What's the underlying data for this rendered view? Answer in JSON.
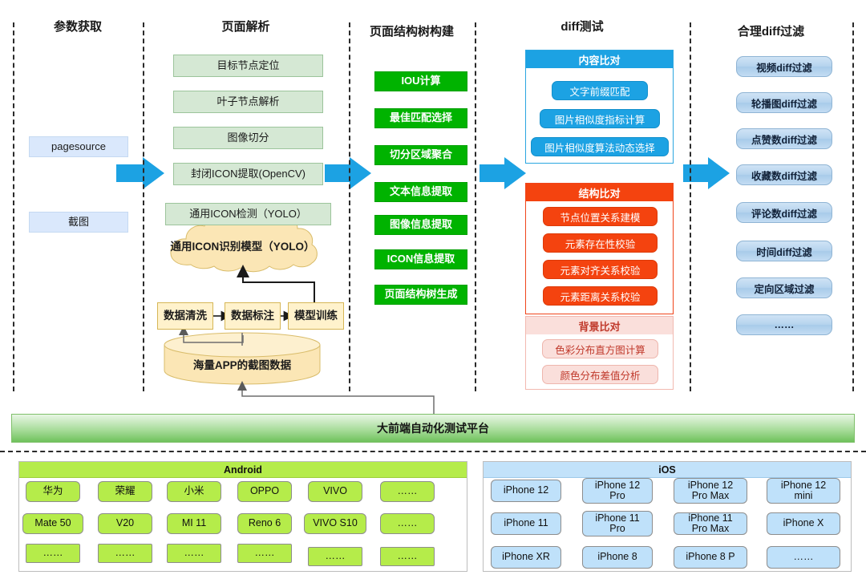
{
  "columns": [
    {
      "title": "参数获取"
    },
    {
      "title": "页面解析"
    },
    {
      "title": "页面结构树构建"
    },
    {
      "title": "diff测试"
    },
    {
      "title": "合理diff过滤"
    }
  ],
  "inputs": [
    {
      "label": "pagesource"
    },
    {
      "label": "截图"
    }
  ],
  "page_parse": {
    "steps": [
      {
        "label": "目标节点定位"
      },
      {
        "label": "叶子节点解析"
      },
      {
        "label": "图像切分"
      },
      {
        "label": "封闭ICON提取(OpenCV)"
      },
      {
        "label": "通用ICON检测（YOLO）"
      }
    ],
    "model_cloud": "通用ICON识别模型（YOLO）",
    "pipeline": [
      {
        "label": "数据清洗"
      },
      {
        "label": "数据标注"
      },
      {
        "label": "模型训练"
      }
    ],
    "datastore": "海量APP的截图数据"
  },
  "tree_build": {
    "steps": [
      {
        "label": "IOU计算"
      },
      {
        "label": "最佳匹配选择"
      },
      {
        "label": "切分区域聚合"
      },
      {
        "label": "文本信息提取"
      },
      {
        "label": "图像信息提取"
      },
      {
        "label": "ICON信息提取"
      },
      {
        "label": "页面结构树生成"
      }
    ]
  },
  "diff_test": {
    "panels": [
      {
        "title": "内容比对",
        "theme": "blue",
        "items": [
          {
            "label": "文字前缀匹配"
          },
          {
            "label": "图片相似度指标计算"
          },
          {
            "label": "图片相似度算法动态选择"
          }
        ]
      },
      {
        "title": "结构比对",
        "theme": "orange",
        "items": [
          {
            "label": "节点位置关系建模"
          },
          {
            "label": "元素存在性校验"
          },
          {
            "label": "元素对齐关系校验"
          },
          {
            "label": "元素距离关系校验"
          }
        ]
      },
      {
        "title": "背景比对",
        "theme": "pink",
        "items": [
          {
            "label": "色彩分布直方图计算"
          },
          {
            "label": "颜色分布差值分析"
          }
        ]
      }
    ]
  },
  "diff_filter": {
    "items": [
      {
        "label": "视频diff过滤"
      },
      {
        "label": "轮播图diff过滤"
      },
      {
        "label": "点赞数diff过滤"
      },
      {
        "label": "收藏数diff过滤"
      },
      {
        "label": "评论数diff过滤"
      },
      {
        "label": "时间diff过滤"
      },
      {
        "label": "定向区域过滤"
      },
      {
        "label": "……"
      }
    ]
  },
  "platform": {
    "label": "大前端自动化测试平台"
  },
  "devices": {
    "android": {
      "title": "Android",
      "rows": [
        [
          "华为",
          "荣耀",
          "小米",
          "OPPO",
          "VIVO",
          "……"
        ],
        [
          "Mate 50",
          "V20",
          "MI 11",
          "Reno 6",
          "VIVO S10",
          "……"
        ],
        [
          "……",
          "……",
          "……",
          "……",
          "……",
          "……"
        ]
      ]
    },
    "ios": {
      "title": "iOS",
      "rows": [
        [
          "iPhone 12",
          "iPhone 12\nPro",
          "iPhone 12\nPro Max",
          "iPhone 12\nmini"
        ],
        [
          "iPhone 11",
          "iPhone 11\nPro",
          "iPhone 11\nPro Max",
          "iPhone X"
        ],
        [
          "iPhone XR",
          "iPhone 8",
          "iPhone 8 P",
          "……"
        ]
      ]
    }
  },
  "colors": {
    "arrow_blue": "#1ca2e3",
    "soft_green": "#d5e8d4",
    "solid_green": "#00b300",
    "orange": "#f4430f",
    "yellow": "#fff2cc",
    "android_green": "#b5ec4a",
    "ios_blue": "#bfe1fa"
  }
}
